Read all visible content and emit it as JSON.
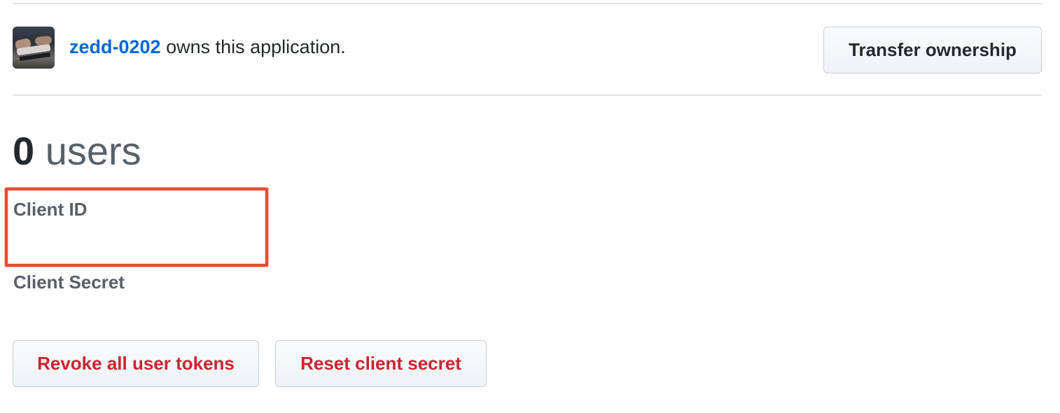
{
  "owner": {
    "username": "zedd-0202",
    "suffix_text": "owns this application.",
    "avatar_alt": "avatar"
  },
  "transfer_button": {
    "label": "Transfer ownership"
  },
  "users": {
    "count": "0",
    "label": "users"
  },
  "credentials": {
    "client_id_label": "Client ID",
    "client_id_value": "",
    "client_secret_label": "Client Secret",
    "client_secret_value": ""
  },
  "actions": {
    "revoke_label": "Revoke all user tokens",
    "reset_label": "Reset client secret"
  },
  "annotation": {
    "highlight_color": "#ea4c32"
  },
  "colors": {
    "link": "#0366d6",
    "danger": "#cb2431",
    "text": "#24292e",
    "muted": "#586069",
    "border": "#e1e4e8"
  }
}
